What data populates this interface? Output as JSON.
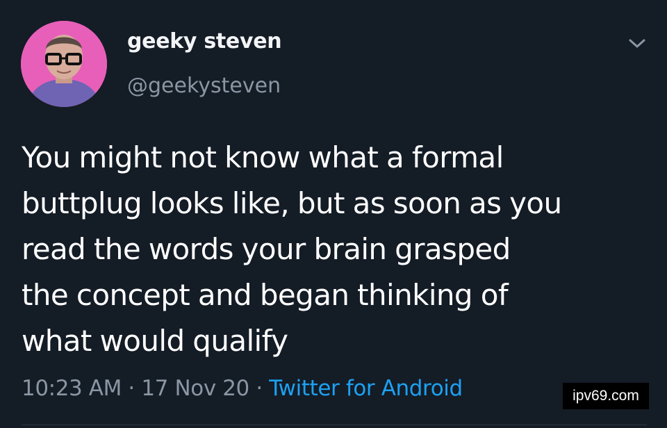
{
  "tweet": {
    "display_name": "geeky steven",
    "handle": "@geekysteven",
    "text_lines": [
      "You might not know what a formal",
      "buttplug looks like, but as soon as you",
      "read the words your brain grasped",
      "the concept and began thinking of",
      "what would qualify"
    ],
    "time": "10:23 AM",
    "separator": "·",
    "date": "17 Nov 20",
    "source": "Twitter for Android"
  },
  "icons": {
    "more": "chevron-down-icon",
    "avatar": "profile-avatar"
  },
  "colors": {
    "background": "#141c26",
    "text": "#ffffff",
    "muted": "#8a96a3",
    "link": "#1da1f2",
    "avatar_bg": "#e85fb9"
  },
  "watermark": "ipv69.com"
}
